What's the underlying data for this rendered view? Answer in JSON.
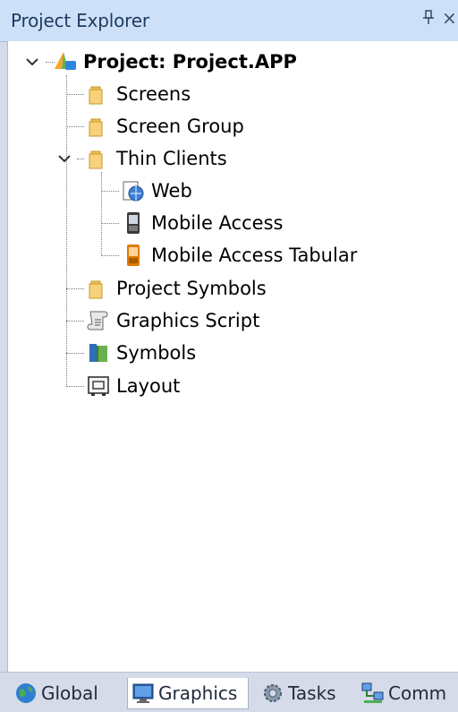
{
  "panel": {
    "title": "Project Explorer",
    "pin_glyph": "⅁",
    "close_glyph": "×"
  },
  "tree": {
    "root": {
      "label": "Project: Project.APP",
      "icon": "project-app-icon",
      "expanded": true
    },
    "items": [
      {
        "label": "Screens",
        "icon": "folder-icon"
      },
      {
        "label": "Screen Group",
        "icon": "folder-icon"
      },
      {
        "label": "Thin Clients",
        "icon": "folder-icon",
        "expanded": true,
        "children": [
          {
            "label": "Web",
            "icon": "web-icon"
          },
          {
            "label": "Mobile Access",
            "icon": "mobile-device-icon"
          },
          {
            "label": "Mobile Access Tabular",
            "icon": "mobile-tabular-icon"
          }
        ]
      },
      {
        "label": "Project Symbols",
        "icon": "folder-icon"
      },
      {
        "label": "Graphics Script",
        "icon": "script-icon"
      },
      {
        "label": "Symbols",
        "icon": "symbols-book-icon"
      },
      {
        "label": "Layout",
        "icon": "layout-icon"
      }
    ]
  },
  "tabs": [
    {
      "label": "Global",
      "icon": "globe-icon",
      "active": false
    },
    {
      "label": "Graphics",
      "icon": "monitor-icon",
      "active": true
    },
    {
      "label": "Tasks",
      "icon": "gear-icon",
      "active": false
    },
    {
      "label": "Comm",
      "icon": "network-icon",
      "active": false
    }
  ],
  "colors": {
    "title_bar": "#cde0f7",
    "title_text": "#1e3a5f",
    "folder": "#f2c14e",
    "tab_bar": "#d6dbe9"
  }
}
